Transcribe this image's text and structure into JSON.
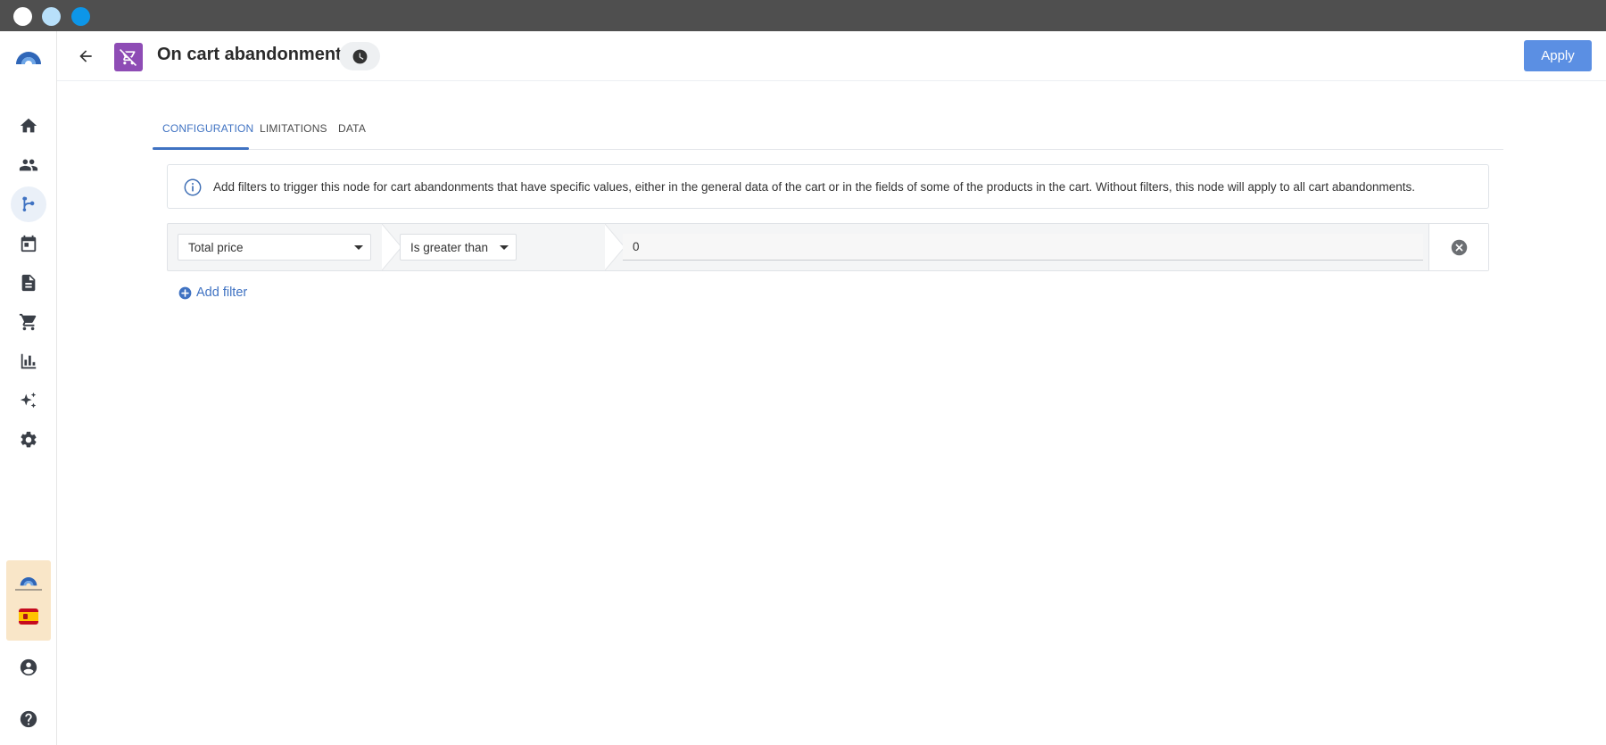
{
  "window": {
    "buttons": [
      "close",
      "minimize",
      "maximize"
    ]
  },
  "sidebar": {
    "logo_icon": "rainbow-arc-logo",
    "items": [
      {
        "name": "home",
        "icon": "home-icon",
        "active": false
      },
      {
        "name": "contacts",
        "icon": "people-icon",
        "active": false
      },
      {
        "name": "automations",
        "icon": "flow-branch-icon",
        "active": true
      },
      {
        "name": "calendar",
        "icon": "calendar-icon",
        "active": false
      },
      {
        "name": "documents",
        "icon": "document-icon",
        "active": false
      },
      {
        "name": "shop",
        "icon": "cart-icon",
        "active": false
      },
      {
        "name": "reports",
        "icon": "bar-chart-icon",
        "active": false
      },
      {
        "name": "ai",
        "icon": "sparkles-icon",
        "active": false
      },
      {
        "name": "settings",
        "icon": "gear-icon",
        "active": false
      }
    ],
    "bottom": {
      "account_icon": "user-circle-icon",
      "help_icon": "help-icon",
      "language_flag": "spain-flag-icon"
    }
  },
  "header": {
    "title": "On cart abandonment",
    "node_icon": "cart-off-icon",
    "node_color": "#8e4cb5",
    "history_icon": "clock-icon",
    "apply_label": "Apply",
    "accent": "#5b8fe3"
  },
  "tabs": [
    {
      "label": "CONFIGURATION",
      "active": true
    },
    {
      "label": "LIMITATIONS",
      "active": false
    },
    {
      "label": "DATA",
      "active": false
    }
  ],
  "info": {
    "icon": "info-icon",
    "text": "Add filters to trigger this node for cart abandonments that have specific values, either in the general data of the cart or in the fields of some of the products in the cart. Without filters, this node will apply to all cart abandonments."
  },
  "filters": [
    {
      "field": "Total price",
      "operator": "Is greater than",
      "value": "0"
    }
  ],
  "add_filter_label": "Add filter"
}
